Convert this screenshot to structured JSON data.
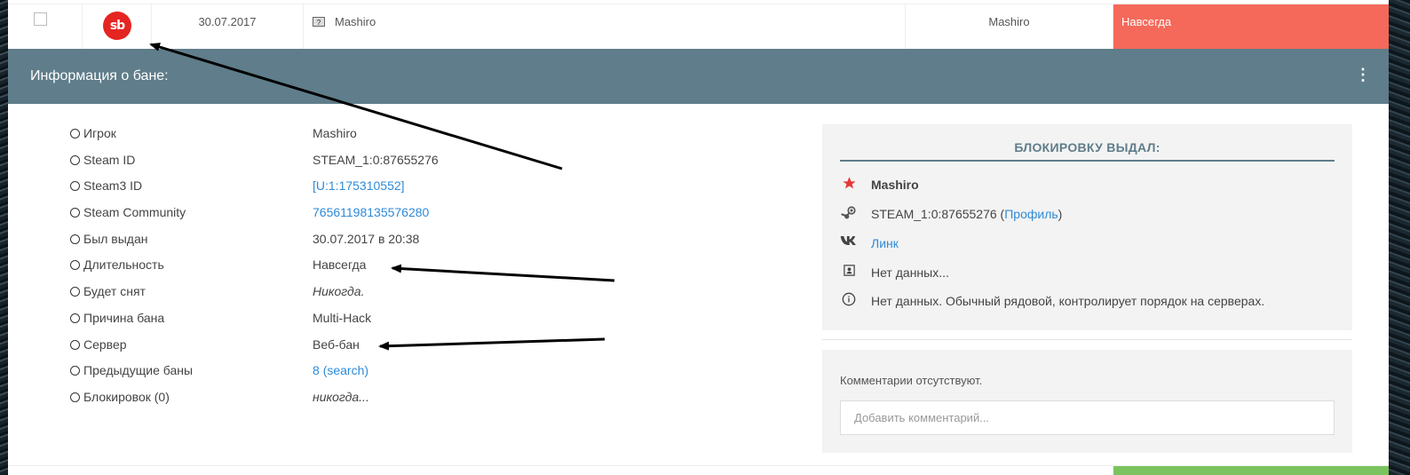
{
  "ban_row": {
    "date": "30.07.2017",
    "player": "Mashiro",
    "admin": "Mashiro",
    "length": "Навсегда",
    "game_icon_glyph": "?",
    "logo_text": "sb",
    "length_color": "#f4695a"
  },
  "info_panel": {
    "title": "Информация о бане:",
    "menu_glyph": "⋮",
    "rows": [
      {
        "label": "Игрок",
        "value": "Mashiro"
      },
      {
        "label": "Steam ID",
        "value": "STEAM_1:0:87655276"
      },
      {
        "label": "Steam3 ID",
        "value": "[U:1:175310552]"
      },
      {
        "label": "Steam Community",
        "value": "76561198135576280"
      },
      {
        "label": "Был выдан",
        "value": "30.07.2017 в 20:38"
      },
      {
        "label": "Длительность",
        "value": "Навсегда"
      },
      {
        "label": "Будет снят",
        "value": "Никогда."
      },
      {
        "label": "Причина бана",
        "value": "Multi-Hack"
      },
      {
        "label": "Сервер",
        "value": "Веб-бан"
      },
      {
        "label": "Предыдущие баны",
        "value_count": "8",
        "value_link": "(search)"
      },
      {
        "label": "Блокировок (0)",
        "value": "никогда..."
      }
    ]
  },
  "admin_box": {
    "heading": "БЛОКИРОВКУ ВЫДАЛ:",
    "name": "Mashiro",
    "steam_id": "STEAM_1:0:87655276",
    "profile_open": " (",
    "profile_link": "Профиль",
    "profile_close": ")",
    "vk_link": "Линк",
    "contact": "Нет данных...",
    "about": "Нет данных. Обычный рядовой, контролирует порядок на серверах.",
    "icons": [
      "star-icon",
      "steam-icon",
      "vk-icon",
      "contact-card-icon",
      "info-icon"
    ],
    "star_color": "#e53935"
  },
  "comments": {
    "empty_text": "Комментарии отсутствуют.",
    "placeholder": "Добавить комментарий..."
  },
  "colors": {
    "header_bg": "#5f7d8a",
    "link": "#2e8ad8",
    "permanent": "#f4695a",
    "active": "#7bc35f"
  }
}
